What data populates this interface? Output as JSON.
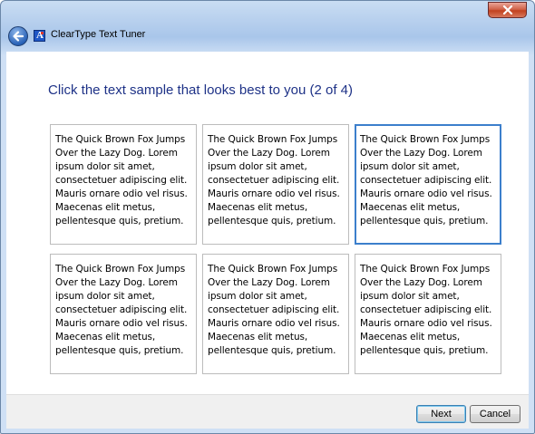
{
  "window": {
    "title": "ClearType Text Tuner"
  },
  "main": {
    "heading": "Click the text sample that looks best to you (2 of 4)",
    "samples": [
      {
        "text": "The Quick Brown Fox Jumps\nOver the Lazy Dog. Lorem\nipsum dolor sit amet,\nconsectetuer adipiscing elit.\nMauris ornare odio vel risus.\nMaecenas elit metus,\npellentesque quis, pretium.",
        "selected": false
      },
      {
        "text": "The Quick Brown Fox Jumps\nOver the Lazy Dog. Lorem\nipsum dolor sit amet,\nconsectetuer adipiscing elit.\nMauris ornare odio vel risus.\nMaecenas elit metus,\npellentesque quis, pretium.",
        "selected": false
      },
      {
        "text": "The Quick Brown Fox Jumps\nOver the Lazy Dog. Lorem\nipsum dolor sit amet,\nconsectetuer adipiscing elit.\nMauris ornare odio vel risus.\nMaecenas elit metus,\npellentesque quis, pretium.",
        "selected": true
      },
      {
        "text": "The Quick Brown Fox Jumps\nOver the Lazy Dog. Lorem\nipsum dolor sit amet,\nconsectetuer adipiscing elit.\nMauris ornare odio vel risus.\nMaecenas elit metus,\npellentesque quis, pretium.",
        "selected": false
      },
      {
        "text": "The Quick Brown Fox Jumps\nOver the Lazy Dog. Lorem\nipsum dolor sit amet,\nconsectetuer adipiscing elit.\nMauris ornare odio vel risus.\nMaecenas elit metus,\npellentesque quis, pretium.",
        "selected": false
      },
      {
        "text": "The Quick Brown Fox Jumps\nOver the Lazy Dog. Lorem\nipsum dolor sit amet,\nconsectetuer adipiscing elit.\nMauris ornare odio vel risus.\nMaecenas elit metus,\npellentesque quis, pretium.",
        "selected": false
      }
    ]
  },
  "footer": {
    "next_label": "Next",
    "cancel_label": "Cancel"
  },
  "icons": {
    "close": "close-icon",
    "back": "back-arrow-icon",
    "app": "cleartype-app-icon"
  },
  "colors": {
    "heading": "#1e3287",
    "selection_border": "#3c7fcc",
    "close_button": "#c2421f"
  }
}
